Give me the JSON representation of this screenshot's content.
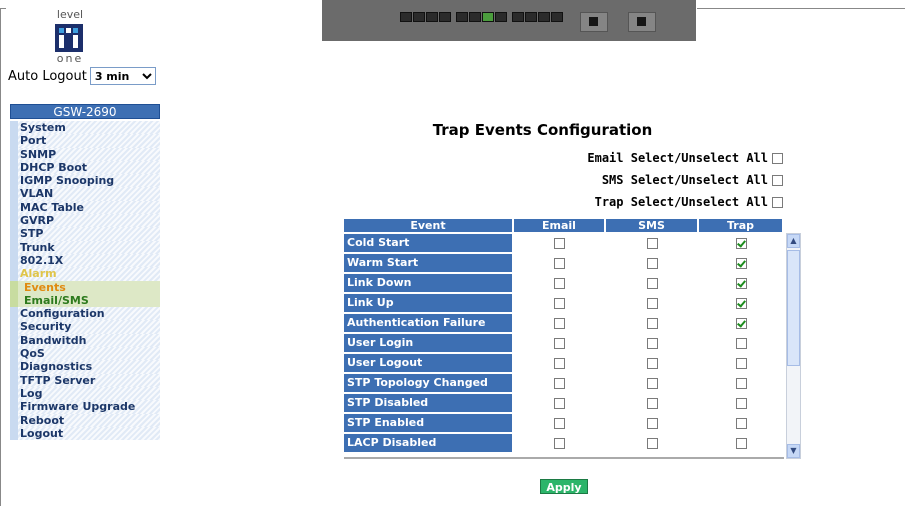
{
  "logo": {
    "top_text": "level",
    "bottom_text": "one"
  },
  "auto_logout": {
    "label": "Auto Logout",
    "value": "3 min"
  },
  "menu": {
    "title": "GSW-2690",
    "items": [
      {
        "label": "System"
      },
      {
        "label": "Port"
      },
      {
        "label": "SNMP"
      },
      {
        "label": "DHCP Boot"
      },
      {
        "label": "IGMP Snooping"
      },
      {
        "label": "VLAN"
      },
      {
        "label": "MAC Table"
      },
      {
        "label": "GVRP"
      },
      {
        "label": "STP"
      },
      {
        "label": "Trunk"
      },
      {
        "label": "802.1X"
      },
      {
        "label": "Alarm"
      },
      {
        "label": "Events"
      },
      {
        "label": "Email/SMS"
      },
      {
        "label": "Configuration"
      },
      {
        "label": "Security"
      },
      {
        "label": "Bandwitdh"
      },
      {
        "label": "QoS"
      },
      {
        "label": "Diagnostics"
      },
      {
        "label": "TFTP Server"
      },
      {
        "label": "Log"
      },
      {
        "label": "Firmware Upgrade"
      },
      {
        "label": "Reboot"
      },
      {
        "label": "Logout"
      }
    ]
  },
  "page": {
    "title": "Trap Events Configuration",
    "email_select_all": "Email Select/Unselect All",
    "sms_select_all": "SMS Select/Unselect All",
    "trap_select_all": "Trap Select/Unselect All"
  },
  "table": {
    "headers": {
      "event": "Event",
      "email": "Email",
      "sms": "SMS",
      "trap": "Trap"
    },
    "rows": [
      {
        "event": "Cold Start",
        "email": false,
        "sms": false,
        "trap": true
      },
      {
        "event": "Warm Start",
        "email": false,
        "sms": false,
        "trap": true
      },
      {
        "event": "Link Down",
        "email": false,
        "sms": false,
        "trap": true
      },
      {
        "event": "Link Up",
        "email": false,
        "sms": false,
        "trap": true
      },
      {
        "event": "Authentication Failure",
        "email": false,
        "sms": false,
        "trap": true
      },
      {
        "event": "User Login",
        "email": false,
        "sms": false,
        "trap": false
      },
      {
        "event": "User Logout",
        "email": false,
        "sms": false,
        "trap": false
      },
      {
        "event": "STP Topology Changed",
        "email": false,
        "sms": false,
        "trap": false
      },
      {
        "event": "STP Disabled",
        "email": false,
        "sms": false,
        "trap": false
      },
      {
        "event": "STP Enabled",
        "email": false,
        "sms": false,
        "trap": false
      },
      {
        "event": "LACP Disabled",
        "email": false,
        "sms": false,
        "trap": false
      }
    ]
  },
  "apply_label": "Apply",
  "colors": {
    "header_blue": "#3d6fb3",
    "apply_green": "#2cb56a",
    "alarm_text": "#e0c54a"
  }
}
